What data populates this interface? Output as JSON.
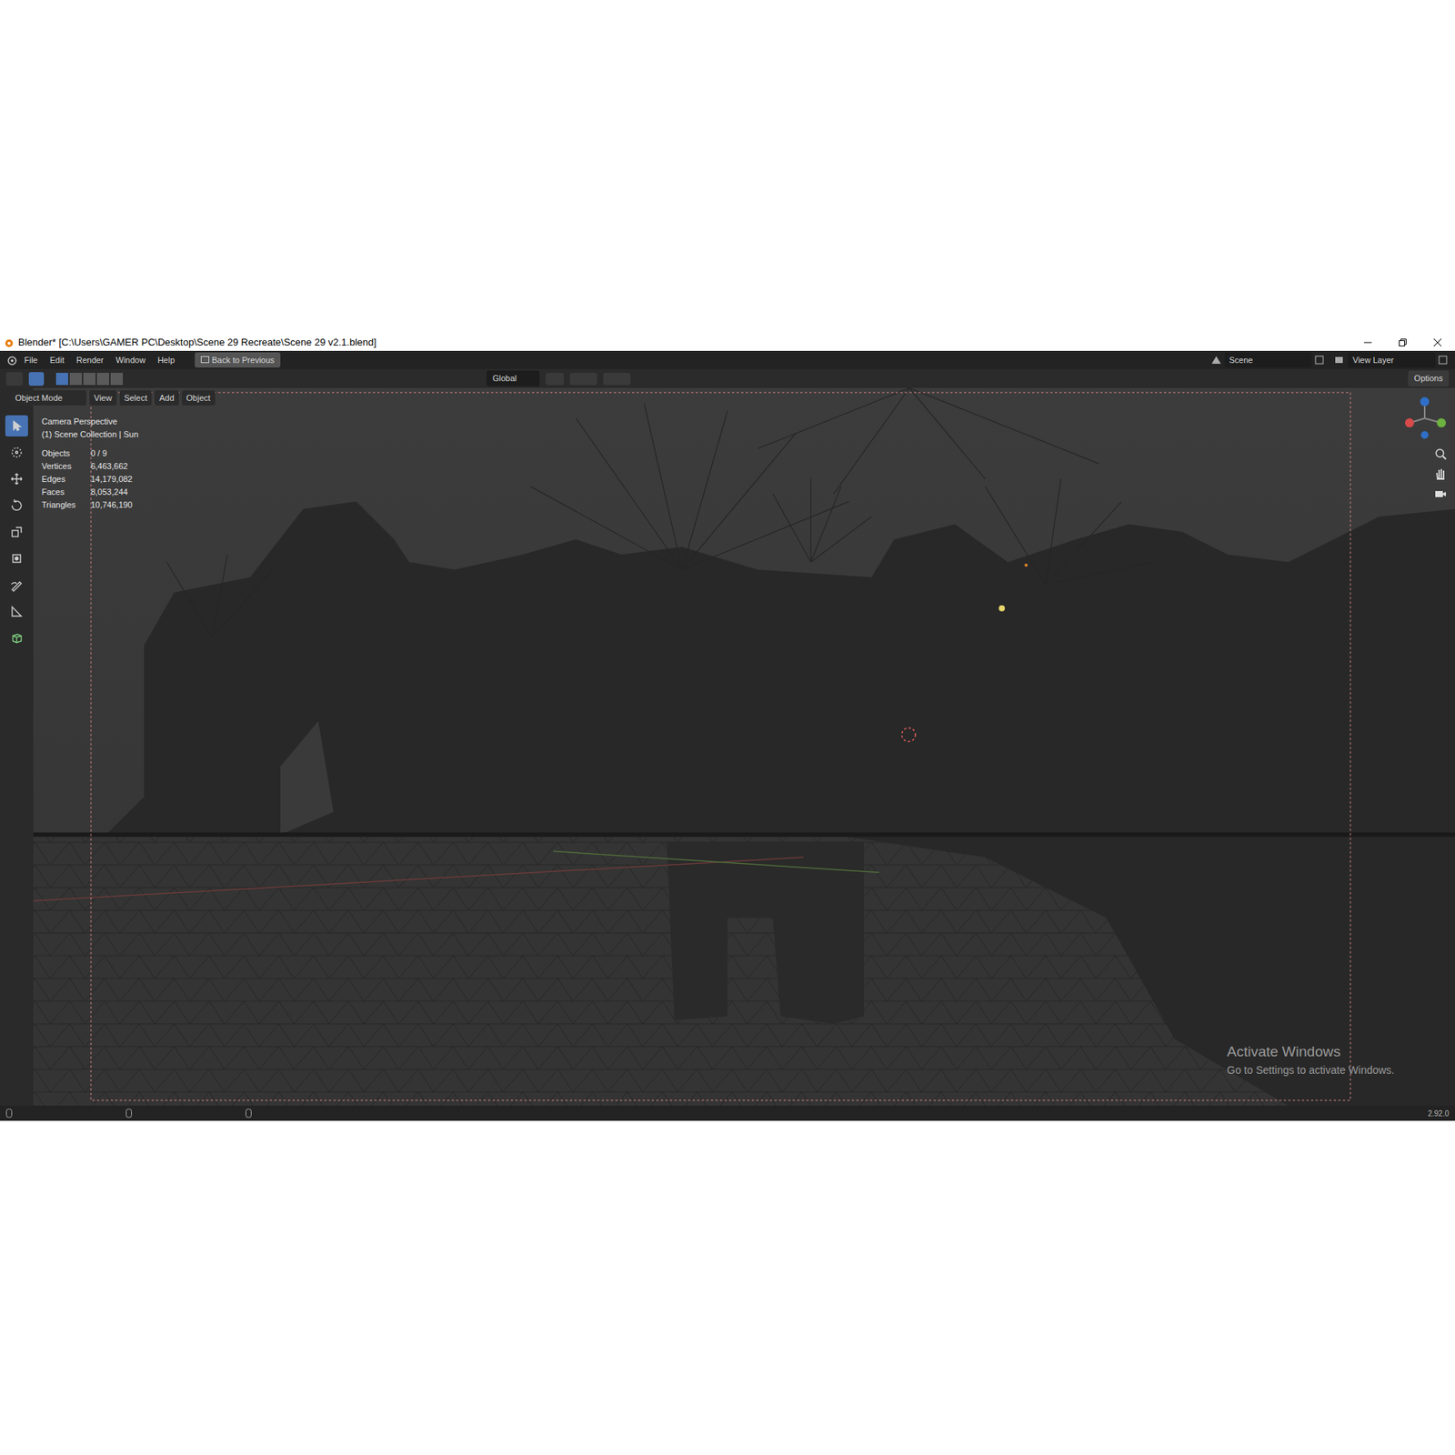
{
  "window": {
    "title": "Blender* [C:\\Users\\GAMER PC\\Desktop\\Scene 29 Recreate\\Scene 29 v2.1.blend]"
  },
  "menu": [
    "File",
    "Edit",
    "Render",
    "Window",
    "Help"
  ],
  "back_button": "Back to Previous",
  "scene": "Scene",
  "view_layer": "View Layer",
  "tool_header": {
    "orientation": "Global",
    "options": "Options"
  },
  "viewport_header": {
    "mode": "Object Mode",
    "menus": [
      "View",
      "Select",
      "Add",
      "Object"
    ]
  },
  "viewport_info": {
    "title": "Camera Perspective",
    "context": "(1) Scene Collection | Sun"
  },
  "stats": [
    {
      "label": "Objects",
      "value": "0 / 9"
    },
    {
      "label": "Vertices",
      "value": "6,463,662"
    },
    {
      "label": "Edges",
      "value": "14,179,082"
    },
    {
      "label": "Faces",
      "value": "8,053,244"
    },
    {
      "label": "Triangles",
      "value": "10,746,190"
    }
  ],
  "tools": [
    {
      "name": "select",
      "selected": true
    },
    {
      "name": "cursor",
      "selected": false
    },
    {
      "name": "move",
      "selected": false
    },
    {
      "name": "rotate",
      "selected": false
    },
    {
      "name": "scale",
      "selected": false
    },
    {
      "name": "transform",
      "selected": false
    },
    {
      "name": "annotate",
      "selected": false
    },
    {
      "name": "measure",
      "selected": false
    },
    {
      "name": "add-cube",
      "selected": false
    }
  ],
  "watermark": {
    "title": "Activate Windows",
    "subtitle": "Go to Settings to activate Windows."
  },
  "status_bar": {
    "version": "2.92.0"
  }
}
